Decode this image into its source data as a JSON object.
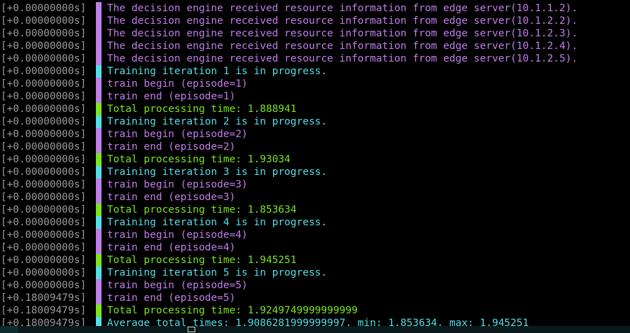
{
  "colors": {
    "background": "#000000",
    "timestamp": "#9a9a9a",
    "info": "#c07ee8",
    "progress": "#52dfe8",
    "success": "#7be51c"
  },
  "log": [
    {
      "ts": "[+0.00000000s]",
      "level": "info",
      "msg": "The decision engine received resource information from edge server(10.1.1.2)."
    },
    {
      "ts": "[+0.00000000s]",
      "level": "info",
      "msg": "The decision engine received resource information from edge server(10.1.2.2)."
    },
    {
      "ts": "[+0.00000000s]",
      "level": "info",
      "msg": "The decision engine received resource information from edge server(10.1.2.3)."
    },
    {
      "ts": "[+0.00000000s]",
      "level": "info",
      "msg": "The decision engine received resource information from edge server(10.1.2.4)."
    },
    {
      "ts": "[+0.00000000s]",
      "level": "info",
      "msg": "The decision engine received resource information from edge server(10.1.2.5)."
    },
    {
      "ts": "[+0.00000000s]",
      "level": "progress",
      "msg": "Training iteration 1 is in progress."
    },
    {
      "ts": "[+0.00000000s]",
      "level": "info",
      "msg": "train begin (episode=1)"
    },
    {
      "ts": "[+0.00000000s]",
      "level": "info",
      "msg": "train end (episode=1)"
    },
    {
      "ts": "[+0.00000000s]",
      "level": "success",
      "msg": "Total processing time: 1.888941"
    },
    {
      "ts": "[+0.00000000s]",
      "level": "progress",
      "msg": "Training iteration 2 is in progress."
    },
    {
      "ts": "[+0.00000000s]",
      "level": "info",
      "msg": "train begin (episode=2)"
    },
    {
      "ts": "[+0.00000000s]",
      "level": "info",
      "msg": "train end (episode=2)"
    },
    {
      "ts": "[+0.00000000s]",
      "level": "success",
      "msg": "Total processing time: 1.93034"
    },
    {
      "ts": "[+0.00000000s]",
      "level": "progress",
      "msg": "Training iteration 3 is in progress."
    },
    {
      "ts": "[+0.00000000s]",
      "level": "info",
      "msg": "train begin (episode=3)"
    },
    {
      "ts": "[+0.00000000s]",
      "level": "info",
      "msg": "train end (episode=3)"
    },
    {
      "ts": "[+0.00000000s]",
      "level": "success",
      "msg": "Total processing time: 1.853634"
    },
    {
      "ts": "[+0.00000000s]",
      "level": "progress",
      "msg": "Training iteration 4 is in progress."
    },
    {
      "ts": "[+0.00000000s]",
      "level": "info",
      "msg": "train begin (episode=4)"
    },
    {
      "ts": "[+0.00000000s]",
      "level": "info",
      "msg": "train end (episode=4)"
    },
    {
      "ts": "[+0.00000000s]",
      "level": "success",
      "msg": "Total processing time: 1.945251"
    },
    {
      "ts": "[+0.00000000s]",
      "level": "progress",
      "msg": "Training iteration 5 is in progress."
    },
    {
      "ts": "[+0.00000000s]",
      "level": "info",
      "msg": "train begin (episode=5)"
    },
    {
      "ts": "[+0.18009479s]",
      "level": "info",
      "msg": "train end (episode=5)"
    },
    {
      "ts": "[+0.18009479s]",
      "level": "success",
      "msg": "Total processing time: 1.9249749999999999"
    },
    {
      "ts": "[+0.18009479s]",
      "level": "progress",
      "msg": "Average total times: 1.9086281999999997, min: 1.853634, max: 1.945251"
    }
  ]
}
